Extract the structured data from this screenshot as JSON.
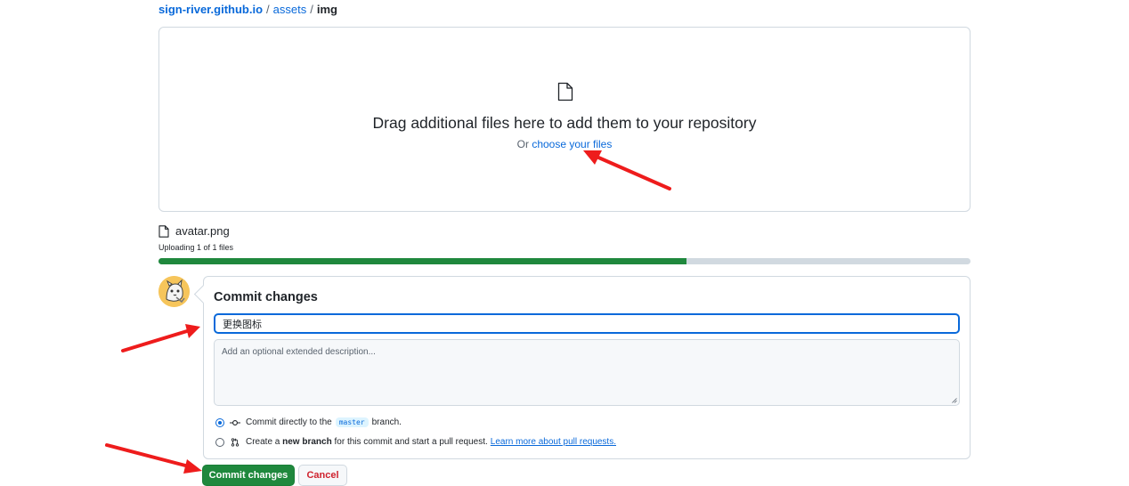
{
  "breadcrumb": {
    "repo": "sign-river.github.io",
    "separator": "/",
    "folder": "assets",
    "current": "img"
  },
  "dropzone": {
    "icon": "file-icon",
    "title": "Drag additional files here to add them to your repository",
    "or_text": "Or",
    "choose_link": "choose your files"
  },
  "upload": {
    "file_name": "avatar.png",
    "status": "Uploading 1 of 1 files",
    "progress_fraction": 0.65
  },
  "commit": {
    "title": "Commit changes",
    "summary_value": "更换图标",
    "description_placeholder": "Add an optional extended description...",
    "option_direct_prefix": "Commit directly to the",
    "option_direct_branch": "master",
    "option_direct_suffix": "branch.",
    "option_new_prefix": "Create a",
    "option_new_bold": "new branch",
    "option_new_suffix": "for this commit and start a pull request.",
    "option_new_link": "Learn more about pull requests.",
    "selected_option": "direct"
  },
  "buttons": {
    "commit_label": "Commit changes",
    "cancel_label": "Cancel"
  },
  "colors": {
    "link": "#0969da",
    "primary_button": "#1f883d",
    "cancel_text": "#cf222e",
    "progress_track": "#d1d9e0",
    "annotation_arrow": "#ee1c1c"
  }
}
